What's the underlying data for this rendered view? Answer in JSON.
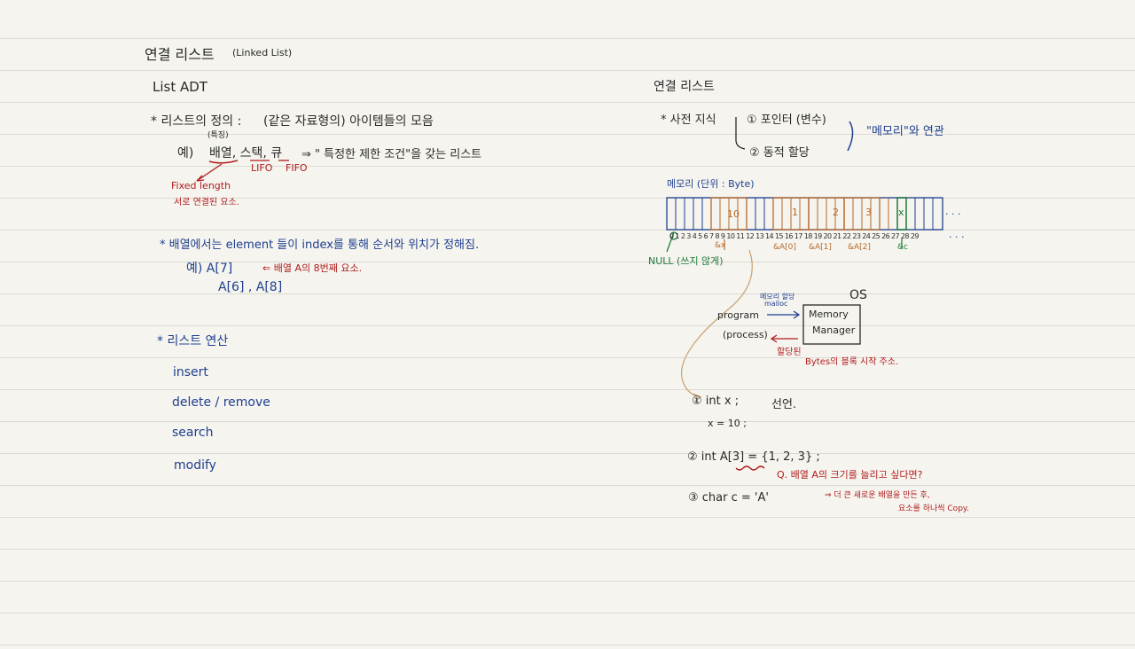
{
  "left": {
    "title": "연결 리스트",
    "title_en": "(Linked List)",
    "list_adt": "List ADT",
    "definition": "* 리스트의 정의 :",
    "definition_paren": "(같은 자료형의) 아이템들의 모음",
    "feature_note": "(특징)",
    "example_prefix": "예)",
    "example_items": "배열, 스택, 큐",
    "example_rest": "⇒ \" 특정한 제한 조건\"을 갖는 리스트",
    "lifo": "LIFO",
    "fifo": "FIFO",
    "fixed_length": "Fixed length",
    "fixed_note": "서로 연결된 요소.",
    "array_note": "* 배열에서는 element 들이 index를 통해 순서와 위치가 정해짐.",
    "array_ex1": "예) A[7]",
    "array_ex1_note": "⇐ 배열 A의 8번째 요소.",
    "array_ex2": "A[6] , A[8]",
    "ops_title": "* 리스트 연산",
    "ops": [
      "insert",
      "delete / remove",
      "search",
      "modify"
    ]
  },
  "right": {
    "title": "연결 리스트",
    "prereq": "* 사전 지식",
    "prereq_1": "① 포인터 (변수)",
    "prereq_2": "② 동적 할당",
    "memory_note": "\"메모리\"와 연관",
    "memory_label": "메모리 (단위 : Byte)",
    "cell_values": [
      "10",
      "1",
      "2",
      "3",
      "x"
    ],
    "index_numbers": "0 1 2 3 4 5 6 7 8 9 10 11 12 13 14 15 16 17 18 19 20 21 22 23 24 25 26 27 28 29",
    "ellipsis": ". . .",
    "null_label": "NULL (쓰지 않게)",
    "addr_x": "&x",
    "addr_a0": "&A[0]",
    "addr_a1": "&A[1]",
    "addr_a2": "&A[2]",
    "addr_c": "&c",
    "os_label": "OS",
    "program_label": "program",
    "process_label": "(process)",
    "mm_line1": "Memory",
    "mm_line2": "Manager",
    "malloc_note": "메모리 할당",
    "malloc": "malloc",
    "returned": "할당된",
    "returned_note": "Bytes의 블록 시작 주소.",
    "code1": "① int x ;",
    "code1_note": "선언.",
    "code1b": "x = 10 ;",
    "code2": "② int A[3] = {1, 2, 3} ;",
    "code2_q": "Q. 배열 A의 크기를 늘리고 싶다면?",
    "code2_a1": "⇒ 더 큰 새로운 배열을 만든 후,",
    "code2_a2": "요소를 하나씩 Copy.",
    "code3": "③ char c = 'A'",
    "colors": {
      "ink": "#2a2a2a",
      "blue": "#1f3f8f",
      "red": "#b01c1c",
      "green": "#1f7a3a",
      "orange": "#b86a2a",
      "line": "#dcdad3",
      "paper": "#f5f4ef"
    }
  }
}
